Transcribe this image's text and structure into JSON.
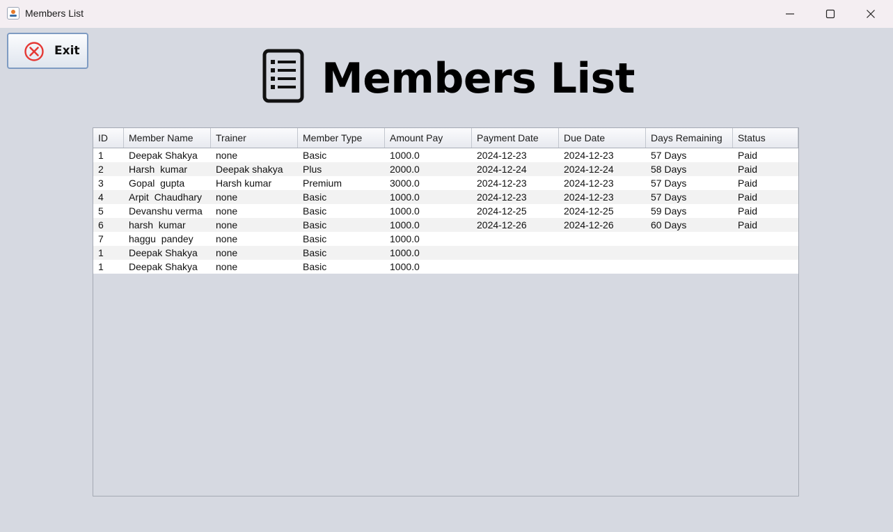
{
  "window": {
    "title": "Members List",
    "icon": "java-app-icon",
    "controls": [
      "minimize-icon",
      "maximize-icon",
      "close-icon"
    ]
  },
  "toolbar": {
    "exit_label": "Exit",
    "exit_icon": "cancel-circle-icon",
    "exit_icon_color": "#e53935"
  },
  "header": {
    "title": "Members List",
    "icon": "list-document-icon"
  },
  "table": {
    "columns": [
      "ID",
      "Member Name",
      "Trainer",
      "Member Type",
      "Amount Pay",
      "Payment Date",
      "Due Date",
      "Days Remaining",
      "Status"
    ],
    "rows": [
      [
        "1",
        "Deepak Shakya",
        "none",
        "Basic",
        "1000.0",
        "2024-12-23",
        "2024-12-23",
        "57 Days",
        "Paid"
      ],
      [
        "2",
        "Harsh  kumar",
        "Deepak shakya",
        "Plus",
        "2000.0",
        "2024-12-24",
        "2024-12-24",
        "58 Days",
        "Paid"
      ],
      [
        "3",
        "Gopal  gupta",
        "Harsh kumar",
        "Premium",
        "3000.0",
        "2024-12-23",
        "2024-12-23",
        "57 Days",
        "Paid"
      ],
      [
        "4",
        "Arpit  Chaudhary",
        "none",
        "Basic",
        "1000.0",
        "2024-12-23",
        "2024-12-23",
        "57 Days",
        "Paid"
      ],
      [
        "5",
        "Devanshu verma",
        "none",
        "Basic",
        "1000.0",
        "2024-12-25",
        "2024-12-25",
        "59 Days",
        "Paid"
      ],
      [
        "6",
        "harsh  kumar",
        "none",
        "Basic",
        "1000.0",
        "2024-12-26",
        "2024-12-26",
        "60 Days",
        "Paid"
      ],
      [
        "7",
        "haggu  pandey",
        "none",
        "Basic",
        "1000.0",
        "",
        "",
        "",
        ""
      ],
      [
        "1",
        "Deepak Shakya",
        "none",
        "Basic",
        "1000.0",
        "",
        "",
        "",
        ""
      ],
      [
        "1",
        "Deepak Shakya",
        "none",
        "Basic",
        "1000.0",
        "",
        "",
        "",
        ""
      ]
    ]
  },
  "colors": {
    "background": "#d6d9e1",
    "titlebar": "#f4eef2",
    "row_alt": "#f2f2f2"
  }
}
